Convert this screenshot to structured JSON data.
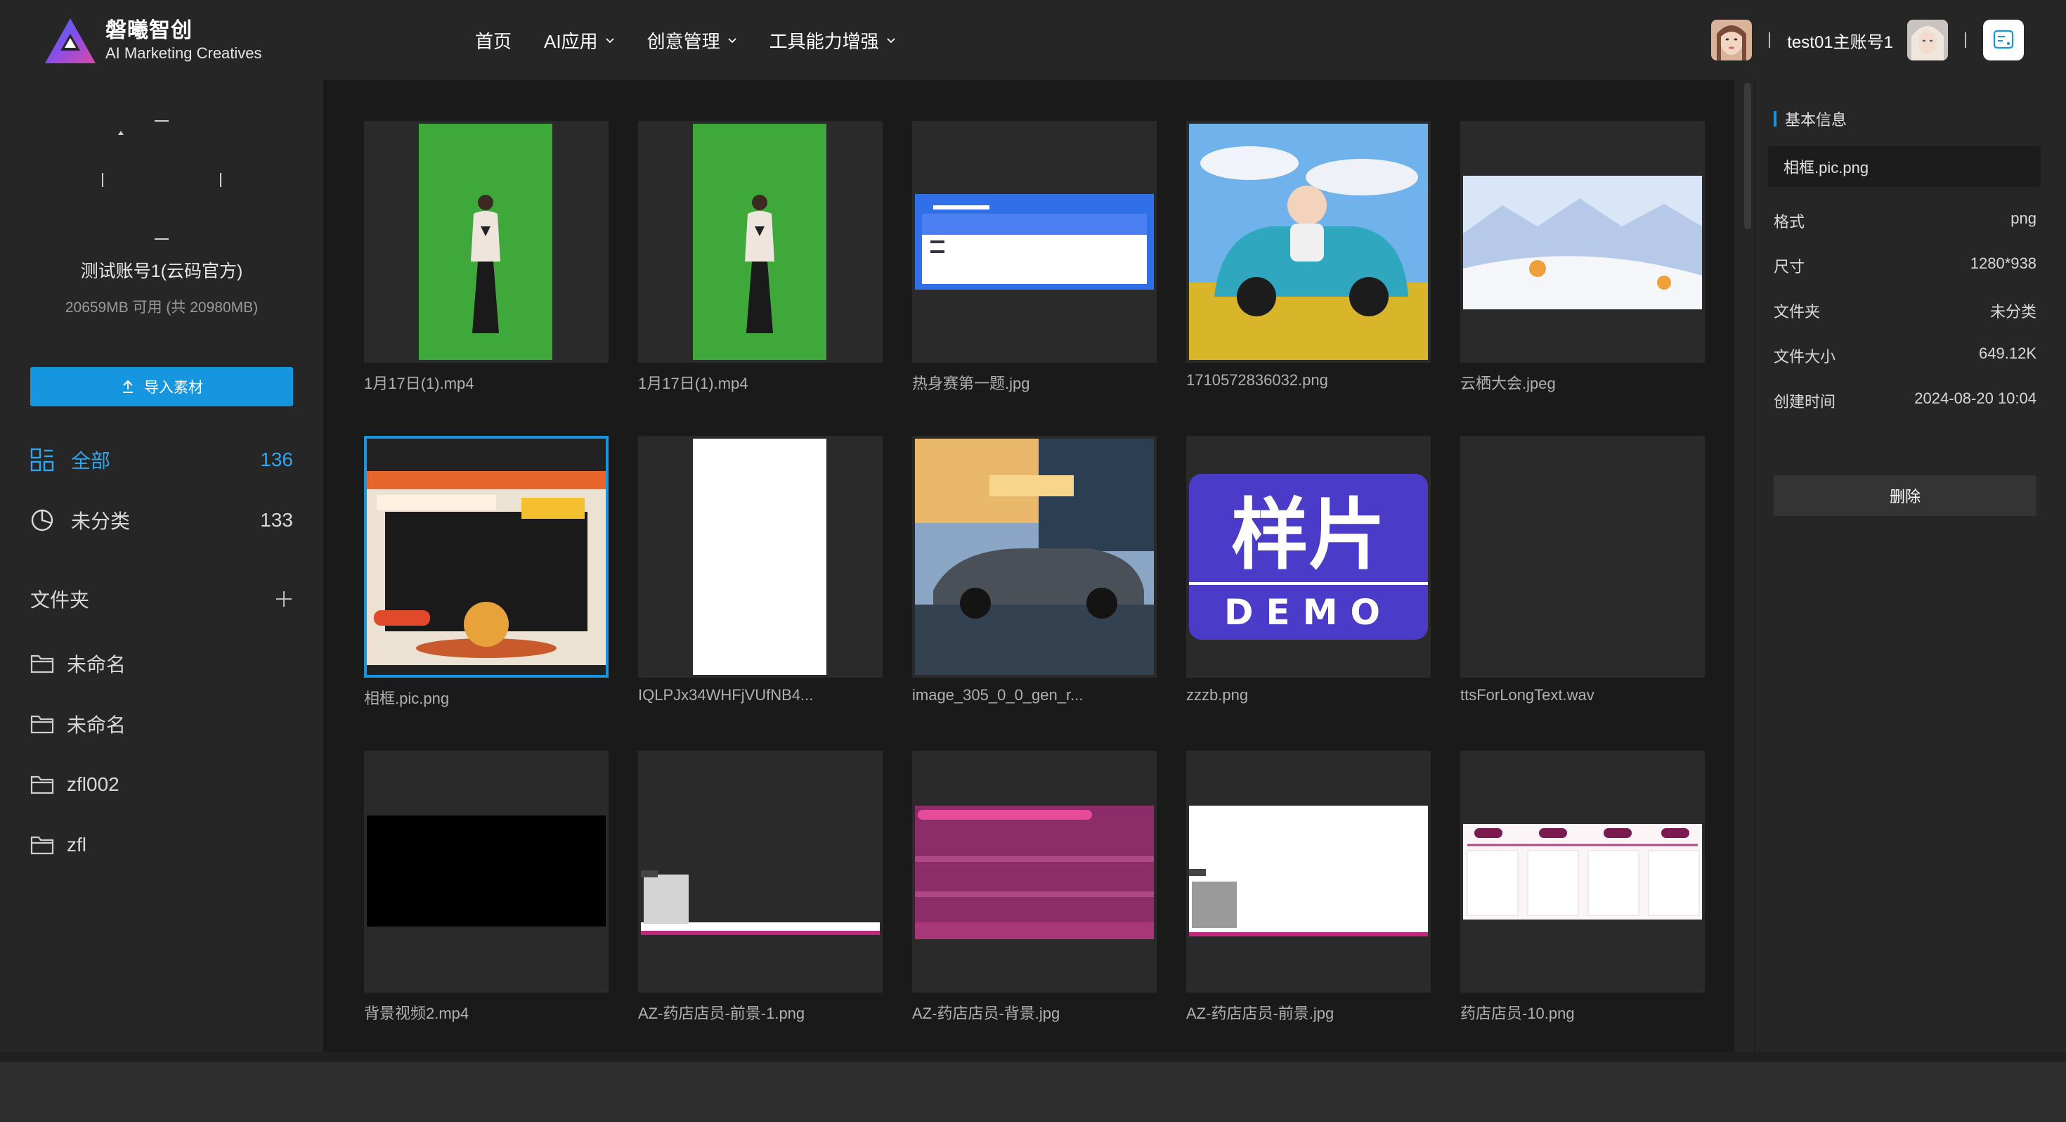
{
  "brand": {
    "name_cn": "磐曦智创",
    "name_en": "AI Marketing Creatives"
  },
  "nav": [
    {
      "label": "首页",
      "dropdown": false
    },
    {
      "label": "AI应用",
      "dropdown": true
    },
    {
      "label": "创意管理",
      "dropdown": true
    },
    {
      "label": "工具能力增强",
      "dropdown": true
    }
  ],
  "user": {
    "name": "test01主账号1"
  },
  "sidebar": {
    "account_name": "测试账号1(云码官方)",
    "quota": "20659MB 可用 (共 20980MB)",
    "import_label": "导入素材",
    "categories": [
      {
        "label": "全部",
        "count": "136",
        "icon": "grid-icon",
        "active": true
      },
      {
        "label": "未分类",
        "count": "133",
        "icon": "pie-chart-icon",
        "active": false
      }
    ],
    "folders_label": "文件夹",
    "folders": [
      "未命名",
      "未命名",
      "zfl002",
      "zfl"
    ]
  },
  "files": [
    {
      "name": "1月17日(1).mp4",
      "kind": "greenscreen"
    },
    {
      "name": "1月17日(1).mp4",
      "kind": "greenscreen"
    },
    {
      "name": "热身赛第一题.jpg",
      "kind": "quiz"
    },
    {
      "name": "1710572836032.png",
      "kind": "baby-car"
    },
    {
      "name": "云栖大会.jpeg",
      "kind": "landscape"
    },
    {
      "name": "相框.pic.png",
      "kind": "frame",
      "selected": true
    },
    {
      "name": "IQLPJx34WHFjVUfNB4...",
      "kind": "white-portrait"
    },
    {
      "name": "image_305_0_0_gen_r...",
      "kind": "car"
    },
    {
      "name": "zzzb.png",
      "kind": "demo"
    },
    {
      "name": "ttsForLongText.wav",
      "kind": "audio"
    },
    {
      "name": "背景视频2.mp4",
      "kind": "black"
    },
    {
      "name": "AZ-药店店员-前景-1.png",
      "kind": "pharmacy-fg"
    },
    {
      "name": "AZ-药店店员-背景.jpg",
      "kind": "pharmacy-bg"
    },
    {
      "name": "AZ-药店店员-前景.jpg",
      "kind": "pharmacy-fg-white"
    },
    {
      "name": "药店店员-10.png",
      "kind": "timeline"
    }
  ],
  "thumb_text": {
    "demo_cn": "样片",
    "demo_en": "DEMO"
  },
  "info": {
    "title": "基本信息",
    "name": "相框.pic.png",
    "props": [
      {
        "key": "格式",
        "value": "png"
      },
      {
        "key": "尺寸",
        "value": "1280*938"
      },
      {
        "key": "文件夹",
        "value": "未分类"
      },
      {
        "key": "文件大小",
        "value": "649.12K"
      },
      {
        "key": "创建时间",
        "value": "2024-08-20 10:04"
      }
    ],
    "delete_label": "删除"
  },
  "colors": {
    "accent": "#1796e0",
    "bg": "#262626",
    "grid_bg": "#1a1a1a"
  }
}
